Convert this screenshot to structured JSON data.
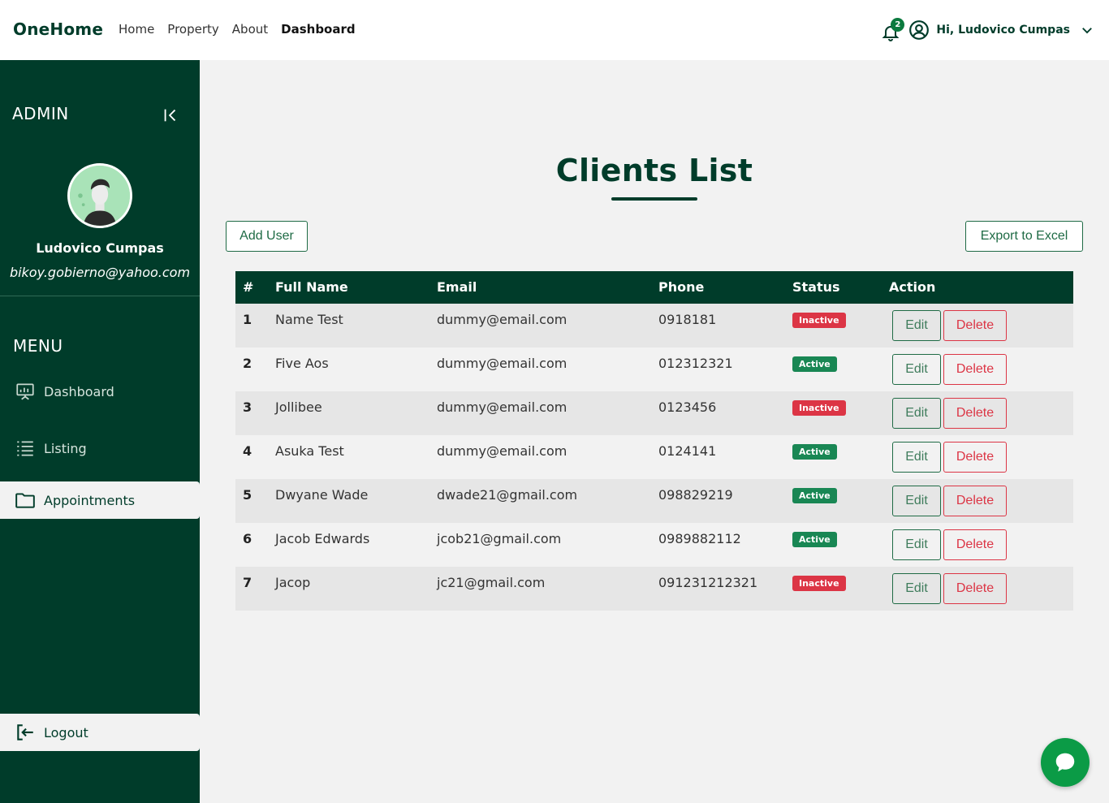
{
  "navbar": {
    "brand": "OneHome",
    "links": [
      {
        "label": "Home",
        "active": false
      },
      {
        "label": "Property",
        "active": false
      },
      {
        "label": "About",
        "active": false
      },
      {
        "label": "Dashboard",
        "active": true
      }
    ],
    "notification_count": "2",
    "greeting": "Hi, Ludovico Cumpas",
    "icons": [
      "bell-icon",
      "user-circle-icon",
      "chevron-down-icon"
    ]
  },
  "sidebar": {
    "admin_title": "ADMIN",
    "profile": {
      "name": "Ludovico Cumpas",
      "email": "bikoy.gobierno@yahoo.com"
    },
    "menu_title": "MENU",
    "items": [
      {
        "label": "Dashboard",
        "icon": "presentation-icon",
        "active": false
      },
      {
        "label": "Listing",
        "icon": "list-icon",
        "active": false
      },
      {
        "label": "Appointments",
        "icon": "folder-icon",
        "active": true
      }
    ],
    "logout_label": "Logout"
  },
  "main": {
    "title": "Clients List",
    "add_user_label": "Add User",
    "export_label": "Export to Excel",
    "table": {
      "headers": [
        "#",
        "Full Name",
        "Email",
        "Phone",
        "Status",
        "Action"
      ],
      "rows": [
        {
          "num": "1",
          "name": "Name Test",
          "email": "dummy@email.com",
          "phone": "0918181",
          "status": "Inactive"
        },
        {
          "num": "2",
          "name": "Five Aos",
          "email": "dummy@email.com",
          "phone": "012312321",
          "status": "Active"
        },
        {
          "num": "3",
          "name": "Jollibee",
          "email": "dummy@email.com",
          "phone": "0123456",
          "status": "Inactive"
        },
        {
          "num": "4",
          "name": "Asuka Test",
          "email": "dummy@email.com",
          "phone": "0124141",
          "status": "Active"
        },
        {
          "num": "5",
          "name": "Dwyane Wade",
          "email": "dwade21@gmail.com",
          "phone": "098829219",
          "status": "Active"
        },
        {
          "num": "6",
          "name": "Jacob Edwards",
          "email": "jcob21@gmail.com",
          "phone": "0989882112",
          "status": "Active"
        },
        {
          "num": "7",
          "name": "Jacop",
          "email": "jc21@gmail.com",
          "phone": "091231212321",
          "status": "Inactive"
        }
      ],
      "edit_label": "Edit",
      "delete_label": "Delete"
    }
  },
  "colors": {
    "primary": "#003c2a",
    "active_badge": "#198754",
    "inactive_badge": "#dc3545",
    "chat_fab": "#0b9b46"
  }
}
